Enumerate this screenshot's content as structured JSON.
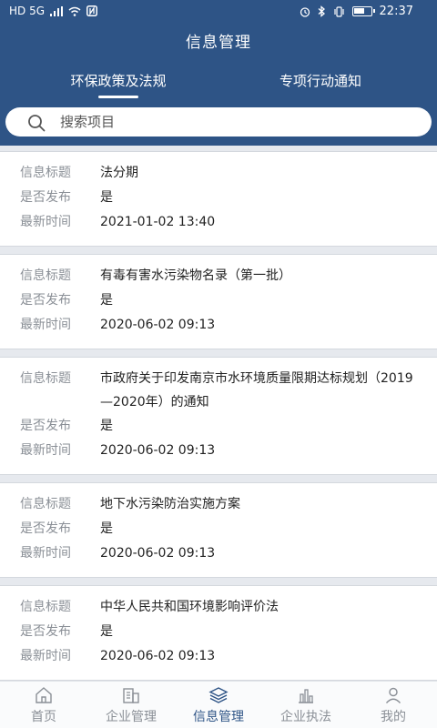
{
  "status_bar": {
    "left_indicators": "HD 5G",
    "time": "22:37"
  },
  "header": {
    "title": "信息管理"
  },
  "tabs": [
    {
      "label": "环保政策及法规",
      "active": true
    },
    {
      "label": "专项行动通知",
      "active": false
    }
  ],
  "search": {
    "placeholder": "搜索项目"
  },
  "field_labels": {
    "title": "信息标题",
    "published": "是否发布",
    "updated": "最新时间"
  },
  "items": [
    {
      "title": "法分期",
      "published": "是",
      "updated": "2021-01-02 13:40"
    },
    {
      "title": "有毒有害水污染物名录（第一批）",
      "published": "是",
      "updated": "2020-06-02 09:13"
    },
    {
      "title": "市政府关于印发南京市水环境质量限期达标规划（2019—2020年）的通知",
      "published": "是",
      "updated": "2020-06-02 09:13"
    },
    {
      "title": "地下水污染防治实施方案",
      "published": "是",
      "updated": "2020-06-02 09:13"
    },
    {
      "title": "中华人民共和国环境影响评价法",
      "published": "是",
      "updated": "2020-06-02 09:13"
    }
  ],
  "bottom_nav": [
    {
      "label": "首页",
      "icon": "home-icon",
      "active": false
    },
    {
      "label": "企业管理",
      "icon": "building-icon",
      "active": false
    },
    {
      "label": "信息管理",
      "icon": "layers-icon",
      "active": true
    },
    {
      "label": "企业执法",
      "icon": "chart-icon",
      "active": false
    },
    {
      "label": "我的",
      "icon": "user-icon",
      "active": false
    }
  ],
  "colors": {
    "header_bg": "#2e5486",
    "active": "#2e5486",
    "inactive": "#8a8f96"
  }
}
